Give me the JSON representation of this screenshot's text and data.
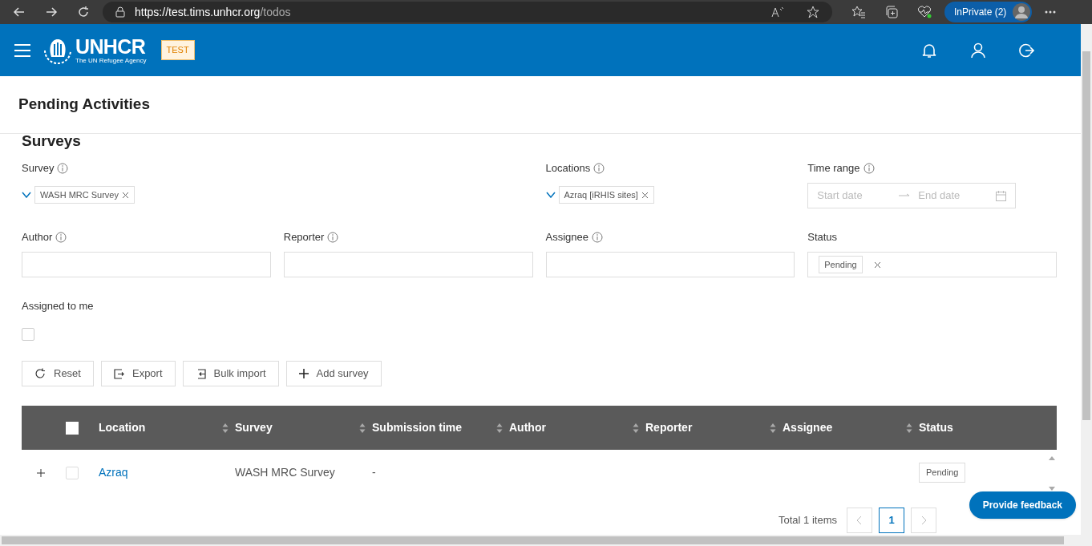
{
  "browser": {
    "url_host": "https://test.tims.unhcr.org",
    "url_path": "/todos",
    "profile": "InPrivate (2)"
  },
  "header": {
    "logo_title": "UNHCR",
    "logo_subtitle": "The UN Refugee Agency",
    "env_badge": "TEST"
  },
  "page_title": "Pending Activities",
  "section_title": "Surveys",
  "filters": [
    {
      "kind": "tags",
      "label": "Survey",
      "info": true,
      "tags": [
        "WASH MRC Survey"
      ]
    },
    {
      "kind": "tags",
      "label": "Locations",
      "info": true,
      "tags": [
        "Azraq [iRHIS sites]"
      ]
    },
    {
      "kind": "daterange",
      "label": "Time range",
      "info": true,
      "start_placeholder": "Start date",
      "end_placeholder": "End date"
    },
    {
      "kind": "text",
      "label": "Author",
      "info": true
    },
    {
      "kind": "text",
      "label": "Reporter",
      "info": true
    },
    {
      "kind": "text",
      "label": "Assignee",
      "info": true
    },
    {
      "kind": "status",
      "label": "Status",
      "info": false,
      "tags": [
        "Pending"
      ]
    },
    {
      "kind": "checkbox",
      "label": "Assigned to me",
      "info": false,
      "checked": false
    }
  ],
  "buttons": [
    {
      "label": "Reset"
    },
    {
      "label": "Export"
    },
    {
      "label": "Bulk import"
    },
    {
      "label": "Add survey"
    }
  ],
  "table": {
    "select_all_checked": false,
    "columns": [
      {
        "label": "Location",
        "sortable": true
      },
      {
        "label": "Survey",
        "sortable": true
      },
      {
        "label": "Submission time",
        "sortable": true
      },
      {
        "label": "Author",
        "sortable": true
      },
      {
        "label": "Reporter",
        "sortable": true
      },
      {
        "label": "Assignee",
        "sortable": true
      },
      {
        "label": "Status",
        "sortable": false
      }
    ],
    "rows": [
      {
        "expanded": false,
        "checked": false,
        "cells": [
          "Azraq",
          "WASH MRC Survey",
          "-"
        ],
        "status": "Pending"
      }
    ]
  },
  "pagination": {
    "total": "Total 1 items",
    "pages": [
      {
        "label": "1",
        "selected": true
      }
    ]
  },
  "feedback_button": "Provide feedback"
}
